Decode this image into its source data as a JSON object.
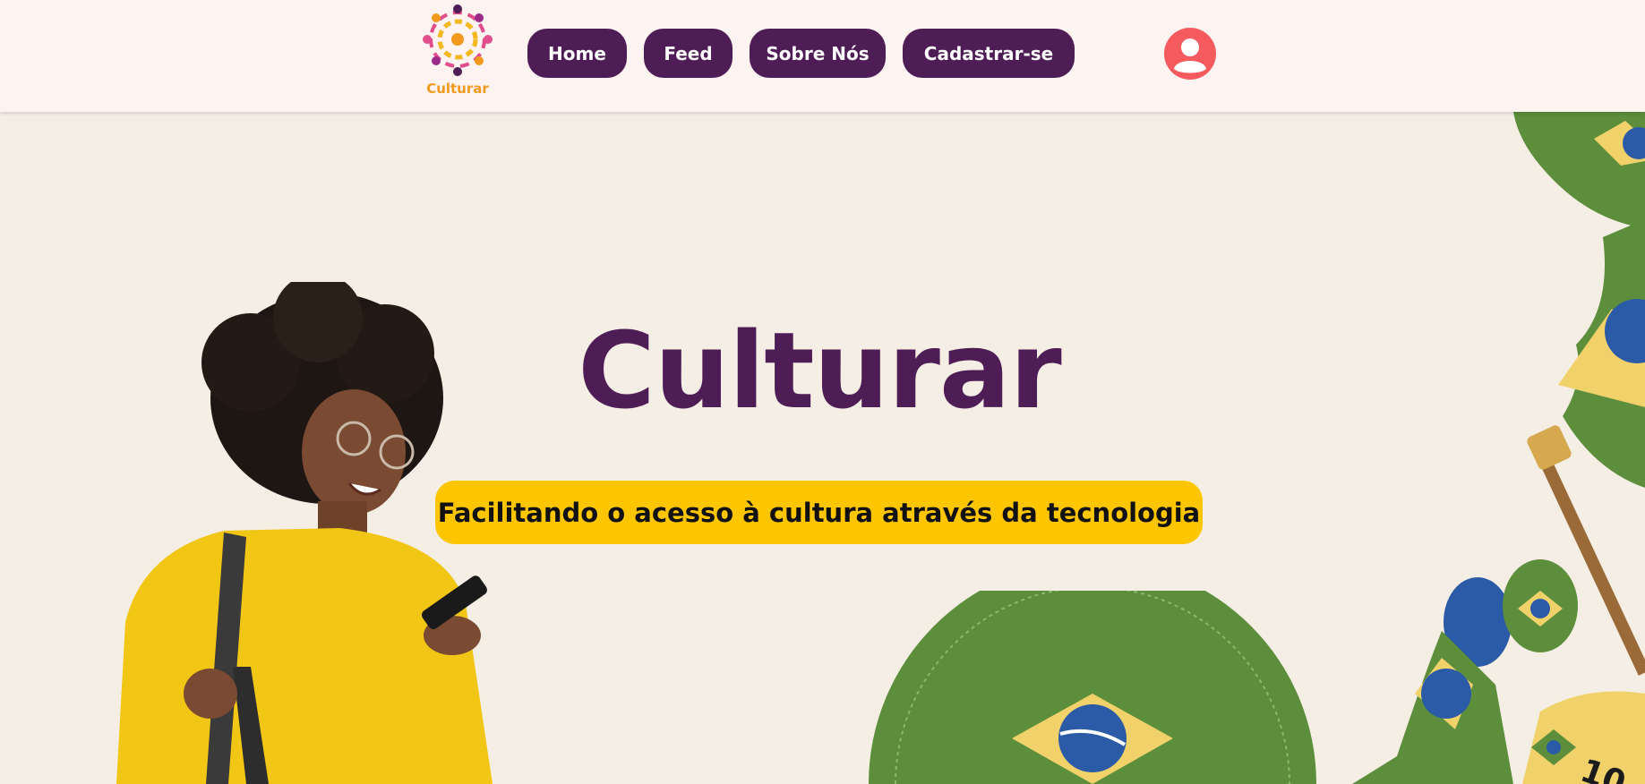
{
  "brand": {
    "name": "Culturar"
  },
  "nav": {
    "home": "Home",
    "feed": "Feed",
    "about": "Sobre Nós",
    "signup": "Cadastrar-se"
  },
  "profile": {
    "icon": "user-icon"
  },
  "hero": {
    "title": "Culturar",
    "tagline": "Facilitando o acesso à cultura através da tecnologia"
  },
  "colors": {
    "accent": "#4f1d56",
    "highlight": "#fdc600",
    "profile": "#f55a5e",
    "logo_text": "#f29a1d",
    "background": "#f4eee5",
    "header": "#fdf3f1"
  }
}
